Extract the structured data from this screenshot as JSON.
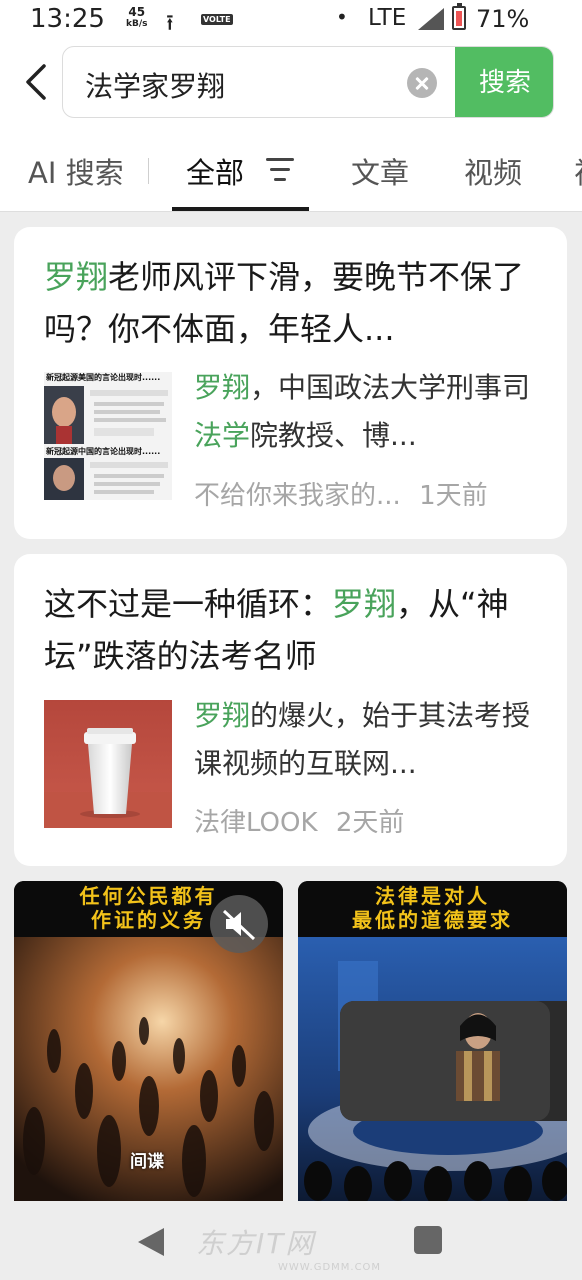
{
  "status_bar": {
    "time": "13:25",
    "net_speed_value": "45",
    "net_speed_unit": "kB/s",
    "volte": "VOLTE",
    "network": "LTE",
    "battery": "71%"
  },
  "search": {
    "query": "法学家罗翔",
    "button": "搜索"
  },
  "tabs": [
    {
      "label": "AI 搜索"
    },
    {
      "label": "全部"
    },
    {
      "label": "文章"
    },
    {
      "label": "视频"
    },
    {
      "label": "视"
    }
  ],
  "results": [
    {
      "title_hl": "罗翔",
      "title_rest": "老师风评下滑，要晚节不保了吗？你不体面，年轻人...",
      "thumb_caption_1": "新冠起源美国的言论出现时......",
      "thumb_caption_2": "新冠起源中国的言论出现时......",
      "snippet_hl_1": "罗翔",
      "snippet_mid": "，中国政法大学刑事司",
      "snippet_hl_2": "法学",
      "snippet_rest": "院教授、博...",
      "source": "不给你来我家的...",
      "time": "1天前"
    },
    {
      "title_pre": "这不过是一种循环：",
      "title_hl": "罗翔",
      "title_post": "，从“神坛”跌落的法考名师",
      "snippet_hl": "罗翔",
      "snippet_rest": "的爆火，始于其法考授课视频的互联网...",
      "source": "法律LOOK",
      "time": "2天前"
    }
  ],
  "videos": [
    {
      "caption_line1": "任何公民都有",
      "caption_line2": "作证的义务",
      "subtitle": "间谍"
    },
    {
      "caption_line1": "法律是对人",
      "caption_line2": "最低的道德要求"
    }
  ],
  "watermark": {
    "text": "东方IT网",
    "url": "WWW.GDMM.COM"
  },
  "colors": {
    "accent_green": "#52bd62",
    "highlight_green": "#49a35b",
    "page_bg": "#ededed"
  },
  "icons": [
    "back-arrow-icon",
    "clear-icon",
    "filter-icon",
    "mute-icon",
    "nav-back-icon",
    "nav-home-icon",
    "nav-recents-icon"
  ]
}
